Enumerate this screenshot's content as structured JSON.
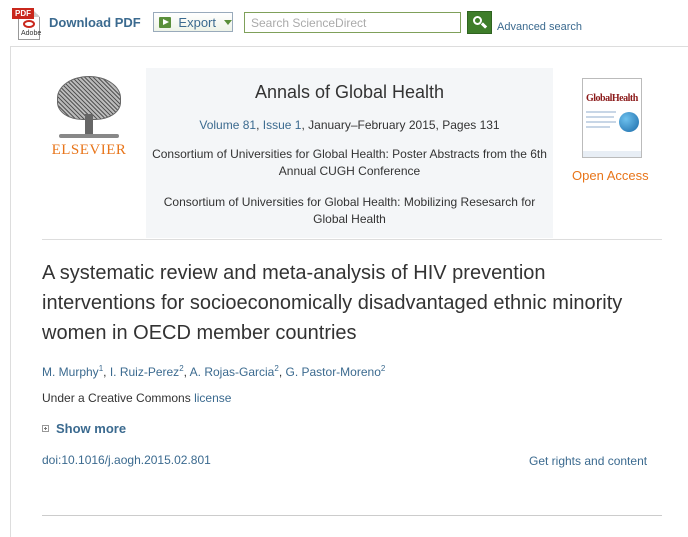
{
  "toolbar": {
    "pdf_icon_tag": "PDF",
    "pdf_icon_brand": "Adobe",
    "download_pdf_label": "Download PDF",
    "export_label": "Export",
    "search_placeholder": "Search ScienceDirect",
    "advanced_search_label": "Advanced search"
  },
  "journal": {
    "publisher": "ELSEVIER",
    "title": "Annals of Global Health",
    "volume": "Volume 81",
    "issue": "Issue 1",
    "issue_details": "January–February 2015, Pages 131",
    "conference_1": "Consortium of Universities for Global Health: Poster Abstracts from the 6th Annual CUGH Conference",
    "conference_2": "Consortium of Universities for Global Health: Mobilizing Resesarch for Global Health",
    "cover_title": "GlobalHealth",
    "access": "Open Access"
  },
  "article": {
    "title": "A systematic review and meta-analysis of HIV prevention interventions for socioeconomically disadvantaged ethnic minority women in OECD member countries",
    "authors": [
      {
        "name": "M. Murphy",
        "aff": "1"
      },
      {
        "name": "I. Ruiz-Perez",
        "aff": "2"
      },
      {
        "name": "A. Rojas-Garcia",
        "aff": "2"
      },
      {
        "name": "G. Pastor-Moreno",
        "aff": "2"
      }
    ],
    "author_separator": ",",
    "license_prefix": "Under a Creative Commons",
    "license_link": "license",
    "show_more_label": "Show more",
    "doi": "doi:10.1016/j.aogh.2015.02.801",
    "rights_link": "Get rights and content"
  },
  "colors": {
    "link": "#3b6a8f",
    "accent_orange": "#e8751a",
    "search_button": "#3e7d2a"
  }
}
